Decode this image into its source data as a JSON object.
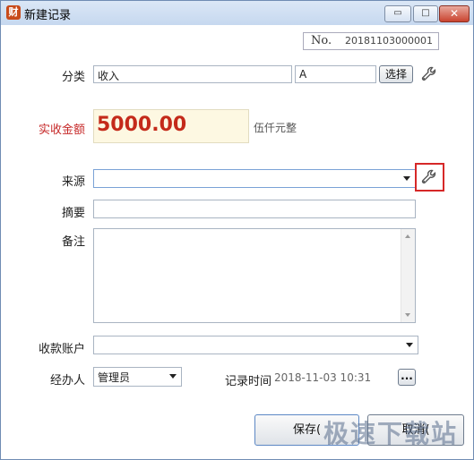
{
  "window": {
    "title": "新建记录",
    "app_icon_glyph": "财",
    "minimize_glyph": "▭",
    "maximize_glyph": "□",
    "close_glyph": "✕"
  },
  "record_no": {
    "label": "No.",
    "value": "20181103000001"
  },
  "category": {
    "label": "分类",
    "value": "收入",
    "subvalue": "A",
    "choose_button": "选择"
  },
  "amount": {
    "label": "实收金额",
    "value": "5000.00",
    "capital": "伍仟元整"
  },
  "source": {
    "label": "来源",
    "value": ""
  },
  "summary": {
    "label": "摘要",
    "value": ""
  },
  "remark": {
    "label": "备注",
    "value": ""
  },
  "account": {
    "label": "收款账户",
    "value": ""
  },
  "handler": {
    "label": "经办人",
    "value": "管理员"
  },
  "record_time": {
    "label": "记录时间",
    "value": "2018-11-03 10:31",
    "more_button": "..."
  },
  "actions": {
    "save_label": "保存(",
    "cancel_label": "取消("
  },
  "watermark": "极速下载站",
  "colors": {
    "highlight": "#d62828",
    "amount_text": "#c42a1a",
    "label_red": "#c62828"
  }
}
